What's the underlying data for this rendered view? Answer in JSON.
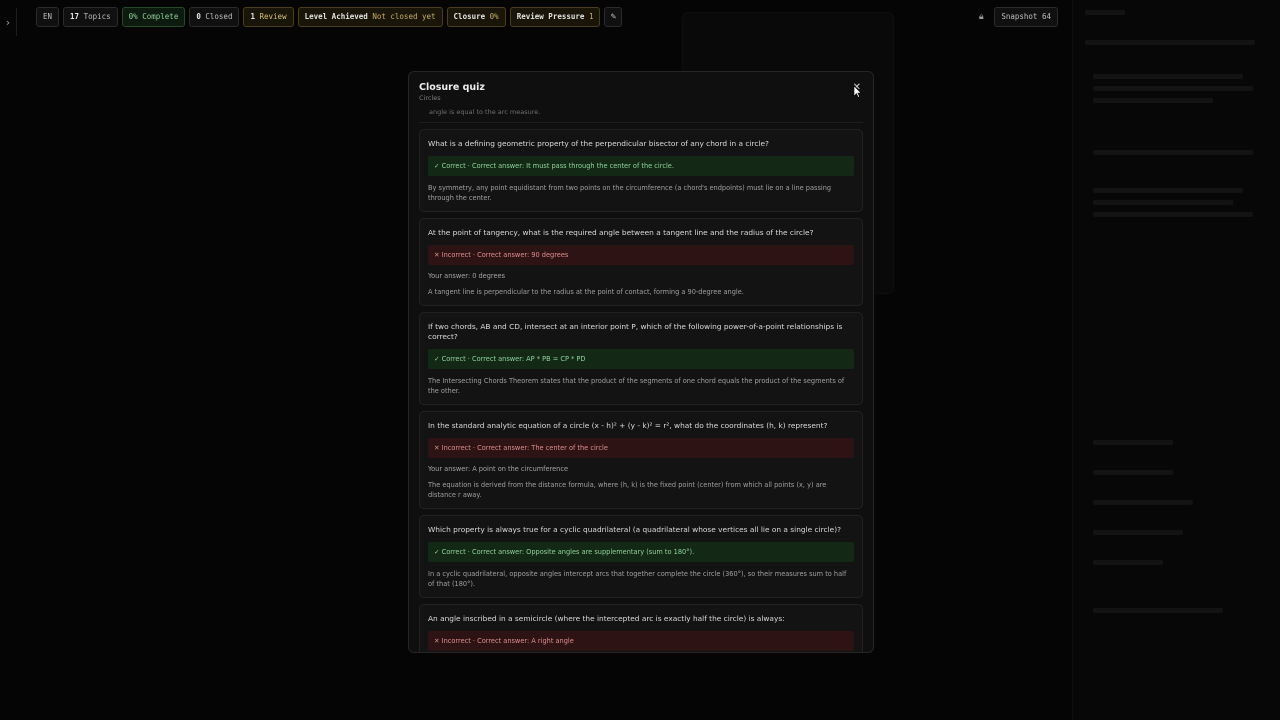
{
  "topbar": {
    "lang": "EN",
    "topics_count": "17",
    "topics_label": "Topics",
    "complete": "0% Complete",
    "closed_count": "0",
    "closed_label": "Closed",
    "review_count": "1",
    "review_label": "Review",
    "level_label": "Level Achieved",
    "level_value": "Not closed yet",
    "closure_label": "Closure",
    "closure_value": "0%",
    "pressure_label": "Review Pressure",
    "pressure_value": "1",
    "snapshot": "Snapshot 64"
  },
  "icons": {
    "sidebar_toggle": "chevron-right-icon",
    "edit": "pencil-icon",
    "lock": "lock-icon",
    "close": "close-icon"
  },
  "colors": {
    "correct": "#8fd49a",
    "incorrect": "#de8f8f",
    "warning": "#d9c27a"
  },
  "modal": {
    "title": "Closure quiz",
    "subtitle": "Circles",
    "fragment": "angle is equal to the arc measure.",
    "questions": [
      {
        "question": "What is a defining geometric property of the perpendicular bisector of any chord in a circle?",
        "result": "✓ Correct · Correct answer: It must pass through the center of the circle.",
        "your_answer": "",
        "explanation": "By symmetry, any point equidistant from two points on the circumference (a chord's endpoints) must lie on a line passing through the center."
      },
      {
        "question": "At the point of tangency, what is the required angle between a tangent line and the radius of the circle?",
        "result": "✕ Incorrect · Correct answer: 90 degrees",
        "your_answer": "Your answer: 0 degrees",
        "explanation": "A tangent line is perpendicular to the radius at the point of contact, forming a 90-degree angle."
      },
      {
        "question": "If two chords, AB and CD, intersect at an interior point P, which of the following power-of-a-point relationships is correct?",
        "result": "✓ Correct · Correct answer: AP * PB = CP * PD",
        "your_answer": "",
        "explanation": "The Intersecting Chords Theorem states that the product of the segments of one chord equals the product of the segments of the other."
      },
      {
        "question": "In the standard analytic equation of a circle (x - h)² + (y - k)² = r², what do the coordinates (h, k) represent?",
        "result": "✕ Incorrect · Correct answer: The center of the circle",
        "your_answer": "Your answer: A point on the circumference",
        "explanation": "The equation is derived from the distance formula, where (h, k) is the fixed point (center) from which all points (x, y) are distance r away."
      },
      {
        "question": "Which property is always true for a cyclic quadrilateral (a quadrilateral whose vertices all lie on a single circle)?",
        "result": "✓ Correct · Correct answer: Opposite angles are supplementary (sum to 180°).",
        "your_answer": "",
        "explanation": "In a cyclic quadrilateral, opposite angles intercept arcs that together complete the circle (360°), so their measures sum to half of that (180°)."
      },
      {
        "question": "An angle inscribed in a semicircle (where the intercepted arc is exactly half the circle) is always:",
        "result": "✕ Incorrect · Correct answer: A right angle",
        "your_answer": "",
        "explanation": ""
      }
    ]
  }
}
